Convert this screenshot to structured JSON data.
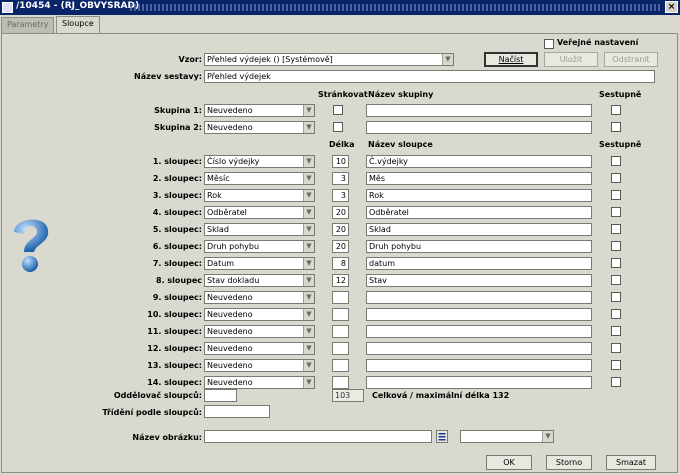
{
  "window": {
    "title": "/10454 - (RJ_OBVYSRAD)",
    "close_glyph": "×"
  },
  "tabs": [
    {
      "label": "Parametry"
    },
    {
      "label": "Sloupce"
    }
  ],
  "top": {
    "vzor_label": "Vzor:",
    "vzor_value": "Přehled výdejek   ()   [Systémově]",
    "nazev_sestavy_label": "Název sestavy:",
    "nazev_sestavy_value": "Přehled výdejek",
    "verejne_label": "Veřejné nastavení",
    "nacist_label": "Načíst",
    "ulozit_label": "Uložit",
    "odstranit_label": "Odstranit"
  },
  "group_headers": {
    "strankovat": "Stránkovat",
    "nazev_skupiny": "Název skupiny",
    "sestupne": "Sestupně"
  },
  "groups": [
    {
      "label": "Skupina 1:",
      "value": "Neuvedeno",
      "name": ""
    },
    {
      "label": "Skupina 2:",
      "value": "Neuvedeno",
      "name": ""
    }
  ],
  "column_headers": {
    "delka": "Délka",
    "nazev_sloupce": "Název sloupce",
    "sestupne": "Sestupně"
  },
  "columns": [
    {
      "label": "1. sloupec:",
      "value": "Číslo výdejky",
      "length": "10",
      "name": "Č.výdejky"
    },
    {
      "label": "2. sloupec:",
      "value": "Měsíc",
      "length": "3",
      "name": "Měs"
    },
    {
      "label": "3. sloupec:",
      "value": "Rok",
      "length": "3",
      "name": "Rok"
    },
    {
      "label": "4. sloupec:",
      "value": "Odběratel",
      "length": "20",
      "name": "Odběratel"
    },
    {
      "label": "5. sloupec:",
      "value": "Sklad",
      "length": "20",
      "name": "Sklad"
    },
    {
      "label": "6. sloupec:",
      "value": "Druh pohybu",
      "length": "20",
      "name": "Druh pohybu"
    },
    {
      "label": "7. sloupec:",
      "value": "Datum",
      "length": "8",
      "name": "datum"
    },
    {
      "label": "8. sloupec",
      "value": "Stav dokladu",
      "length": "12",
      "name": "Stav"
    },
    {
      "label": "9. sloupec:",
      "value": "Neuvedeno",
      "length": "",
      "name": ""
    },
    {
      "label": "10. sloupec:",
      "value": "Neuvedeno",
      "length": "",
      "name": ""
    },
    {
      "label": "11. sloupec:",
      "value": "Neuvedeno",
      "length": "",
      "name": ""
    },
    {
      "label": "12. sloupec:",
      "value": "Neuvedeno",
      "length": "",
      "name": ""
    },
    {
      "label": "13. sloupec:",
      "value": "Neuvedeno",
      "length": "",
      "name": ""
    },
    {
      "label": "14. sloupec:",
      "value": "Neuvedeno",
      "length": "",
      "name": ""
    }
  ],
  "bottom": {
    "oddelovac_label": "Oddělovač sloupců:",
    "oddelovac_value": "",
    "total_value": "103",
    "total_label": "Celková / maximální délka 132",
    "trideni_label": "Třídění podle sloupců:",
    "trideni_value": "",
    "nazev_obrazku_label": "Název obrázku:",
    "nazev_obrazku_value": "",
    "obrazek_select": "",
    "ok_label": "OK",
    "storno_label": "Storno",
    "smazat_label": "Smazat"
  },
  "icons": {
    "help": "question-mark-icon",
    "list": "list-icon",
    "app": "app-icon"
  }
}
